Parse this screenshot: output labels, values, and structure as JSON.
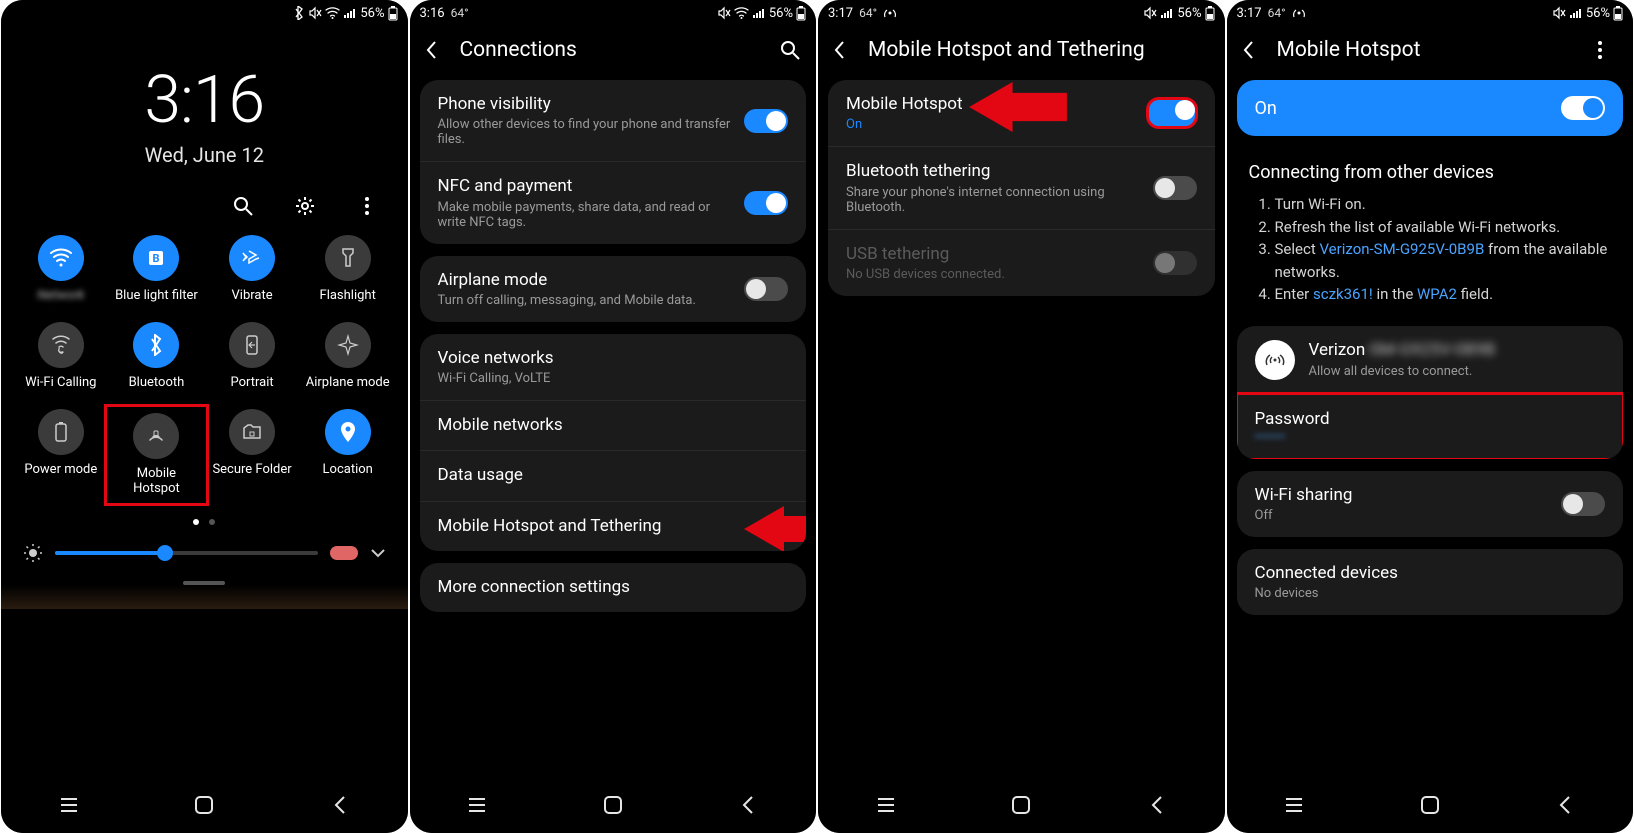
{
  "status": {
    "time1": "",
    "time2": "3:16",
    "time3": "3:17",
    "time4": "3:17",
    "temp1": "",
    "temp2": "64°",
    "temp3": "64°",
    "temp4": "64°",
    "battery": "56%"
  },
  "lock": {
    "clock": "3:16",
    "date": "Wed, June 12"
  },
  "qs": {
    "wifi_label": "",
    "bluelight": "Blue light filter",
    "vibrate": "Vibrate",
    "flashlight": "Flashlight",
    "wcalling": "Wi-Fi Calling",
    "bluetooth": "Bluetooth",
    "portrait": "Portrait",
    "airplane": "Airplane mode",
    "power": "Power mode",
    "hotspot": "Mobile Hotspot",
    "secure": "Secure Folder",
    "location": "Location"
  },
  "screen2": {
    "title": "Connections",
    "phone_vis": "Phone visibility",
    "phone_vis_sub": "Allow other devices to find your phone and transfer files.",
    "nfc": "NFC and payment",
    "nfc_sub": "Make mobile payments, share data, and read or write NFC tags.",
    "airplane": "Airplane mode",
    "airplane_sub": "Turn off calling, messaging, and Mobile data.",
    "voice": "Voice networks",
    "voice_sub": "Wi-Fi Calling, VoLTE",
    "mobnet": "Mobile networks",
    "datausage": "Data usage",
    "tether": "Mobile Hotspot and Tethering",
    "more": "More connection settings"
  },
  "screen3": {
    "title": "Mobile Hotspot and Tethering",
    "hotspot": "Mobile Hotspot",
    "hotspot_sub": "On",
    "btt": "Bluetooth tethering",
    "btt_sub": "Share your phone's internet connection using Bluetooth.",
    "usb": "USB tethering",
    "usb_sub": "No USB devices connected."
  },
  "screen4": {
    "title": "Mobile Hotspot",
    "on": "On",
    "connecting": "Connecting from other devices",
    "step1": "Turn Wi-Fi on.",
    "step2": "Refresh the list of available Wi-Fi networks.",
    "step3a": "Select ",
    "step3link": "Verizon-SM-G925V-0B9B",
    "step3b": " from the available networks.",
    "step4a": "Enter ",
    "step4link": "sczk361!",
    "step4b": " in the ",
    "step4link2": "WPA2",
    "step4c": " field.",
    "ssid": "Verizon",
    "ssid_sub": "Allow all devices to connect.",
    "password_label": "Password",
    "password_value": "•••••••",
    "wifisharing": "Wi-Fi sharing",
    "wifisharing_sub": "Off",
    "connected": "Connected devices",
    "connected_sub": "No devices"
  }
}
